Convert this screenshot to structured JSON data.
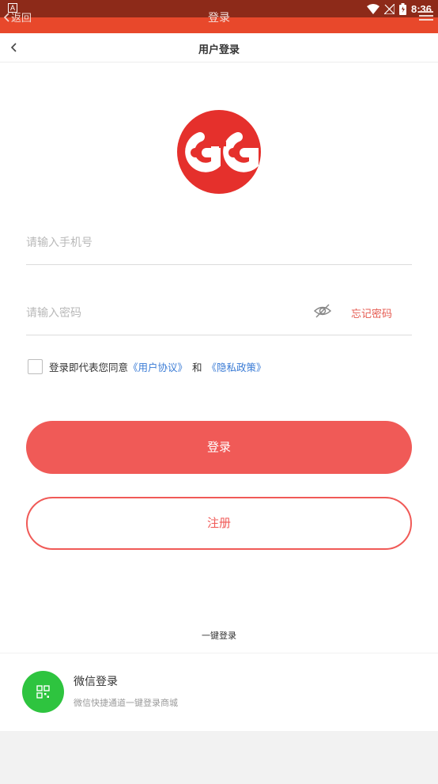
{
  "status_bar": {
    "notification_glyph": "A",
    "time": "8:36"
  },
  "legacy_header": {
    "back_label": "返回",
    "title": "登录"
  },
  "nav": {
    "title": "用户登录"
  },
  "form": {
    "phone_placeholder": "请输入手机号",
    "password_placeholder": "请输入密码",
    "forgot_label": "忘记密码",
    "agreement_prefix": "登录即代表您同意",
    "user_agreement": "《用户协议》",
    "and": "和",
    "privacy_policy": "《隐私政策》",
    "login_label": "登录",
    "register_label": "注册"
  },
  "quick_login": {
    "heading": "一键登录",
    "wechat_title": "微信登录",
    "wechat_subtitle": "微信快捷通道一键登录商城"
  },
  "colors": {
    "accent": "#f05a57",
    "link": "#3a7bd5",
    "wechat": "#2ec43f",
    "header": "#e8482b",
    "statusbar": "#8d2a19"
  },
  "icons": [
    "notification-icon",
    "wifi-icon",
    "signal-icon",
    "battery-icon",
    "menu-icon",
    "back-icon",
    "logo-icon",
    "eye-off-icon",
    "wechat-icon"
  ]
}
